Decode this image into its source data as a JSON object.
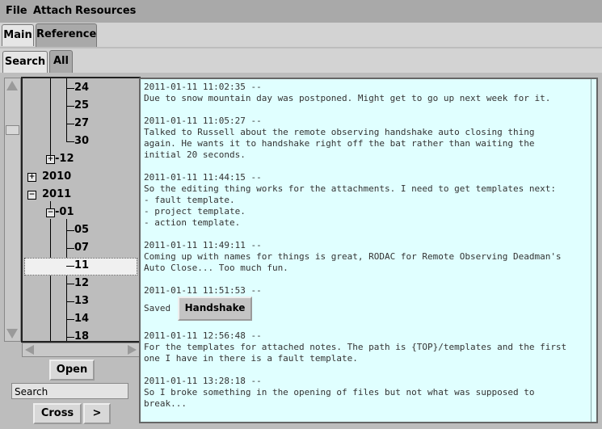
{
  "menu": {
    "file": "File",
    "attach": "Attach",
    "resources": "Resources"
  },
  "tabs_top": {
    "main": "Main",
    "reference": "Reference"
  },
  "tabs_sub": {
    "search": "Search",
    "all": "All"
  },
  "tree": {
    "n24": "24",
    "n25": "25",
    "n27": "27",
    "n30": "30",
    "n12": "-12",
    "y2010": "2010",
    "y2011": "2011",
    "m01": "-01",
    "n05": "05",
    "n07": "07",
    "n11": "11",
    "d12": "12",
    "n13": "13",
    "n14": "14",
    "n18": "18"
  },
  "buttons": {
    "open": "Open",
    "cross": "Cross",
    "next": ">"
  },
  "search": {
    "placeholder": "Search"
  },
  "log": {
    "e1_ts": "2011-01-11 11:02:35 --",
    "e1_body": "Due to snow mountain day was postponed. Might get to go up next week for it.",
    "e2_ts": "2011-01-11 11:05:27 --",
    "e2_body": "Talked to Russell about the remote observing handshake auto closing thing\nagain. He wants it to handshake right off the bat rather than waiting the\ninitial 20 seconds.",
    "e3_ts": "2011-01-11 11:44:15 --",
    "e3_body": "So the editing thing works for the attachments. I need to get templates next:\n- fault template.\n- project template.\n- action template.",
    "e4_ts": "2011-01-11 11:49:11 --",
    "e4_body": "Coming up with names for things is great, RODAC for Remote Observing Deadman's\nAuto Close... Too much fun.",
    "e5_ts": "2011-01-11 11:51:53 --",
    "e5_saved": "Saved",
    "e5_button": "Handshake",
    "e6_ts": "2011-01-11 12:56:48 --",
    "e6_body": "For the templates for attached notes. The path is {TOP}/templates and the first\none I have in there is a fault template.",
    "e7_ts": "2011-01-11 13:28:18 --",
    "e7_body": "So I broke something in the opening of files but not what was supposed to\nbreak..."
  }
}
